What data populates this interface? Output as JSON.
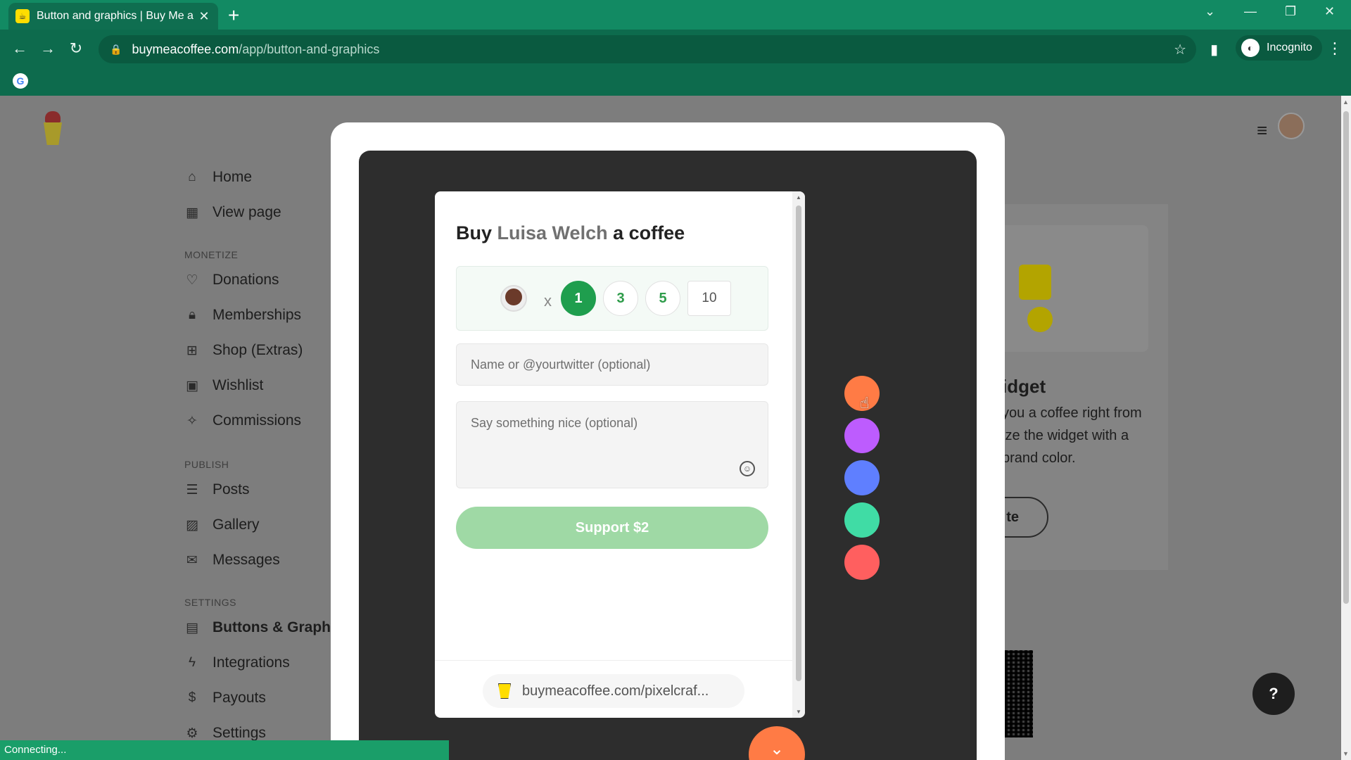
{
  "browser": {
    "tab_title": "Button and graphics | Buy Me a",
    "tab_close": "✕",
    "new_tab": "+",
    "url_host": "buymeacoffee.com",
    "url_path": "/app/button-and-graphics",
    "profile_label": "Incognito"
  },
  "sidebar": {
    "items_top": [
      {
        "label": "Home",
        "icon": "home-icon"
      },
      {
        "label": "View page",
        "icon": "view-page-icon"
      }
    ],
    "monetize_title": "MONETIZE",
    "monetize": [
      {
        "label": "Donations",
        "icon": "heart-icon"
      },
      {
        "label": "Memberships",
        "icon": "lock-icon"
      },
      {
        "label": "Shop (Extras)",
        "icon": "gift-icon"
      },
      {
        "label": "Wishlist",
        "icon": "wishlist-icon"
      },
      {
        "label": "Commissions",
        "icon": "commissions-icon"
      }
    ],
    "publish_title": "PUBLISH",
    "publish": [
      {
        "label": "Posts",
        "icon": "posts-icon"
      },
      {
        "label": "Gallery",
        "icon": "gallery-icon"
      },
      {
        "label": "Messages",
        "icon": "mail-icon"
      }
    ],
    "settings_title": "SETTINGS",
    "settings": [
      {
        "label": "Buttons & Graphic",
        "icon": "buttons-icon"
      },
      {
        "label": "Integrations",
        "icon": "bolt-icon"
      },
      {
        "label": "Payouts",
        "icon": "dollar-icon"
      },
      {
        "label": "Settings",
        "icon": "gear-icon"
      }
    ]
  },
  "background": {
    "heading": "idget",
    "line1": "you a coffee right from",
    "line2": "ize the widget with a",
    "line3": "brand color.",
    "button_fragment": "te",
    "help": "?"
  },
  "widget": {
    "title_prefix": "Buy",
    "creator_name": "Luisa Welch",
    "title_suffix": "a coffee",
    "multiplier": "x",
    "quantities": [
      "1",
      "3",
      "5"
    ],
    "custom_quantity": "10",
    "name_placeholder": "Name or @yourtwitter (optional)",
    "message_placeholder": "Say something nice (optional)",
    "support_label": "Support $2",
    "page_link": "buymeacoffee.com/pixelcraf..."
  },
  "colors": {
    "swatches": [
      "#ff7b45",
      "#bd5cfe",
      "#5f7fff",
      "#40dca5",
      "#ff5f5f"
    ],
    "accent_green": "#1f9e4e"
  },
  "statusbar": {
    "text": "Connecting..."
  }
}
